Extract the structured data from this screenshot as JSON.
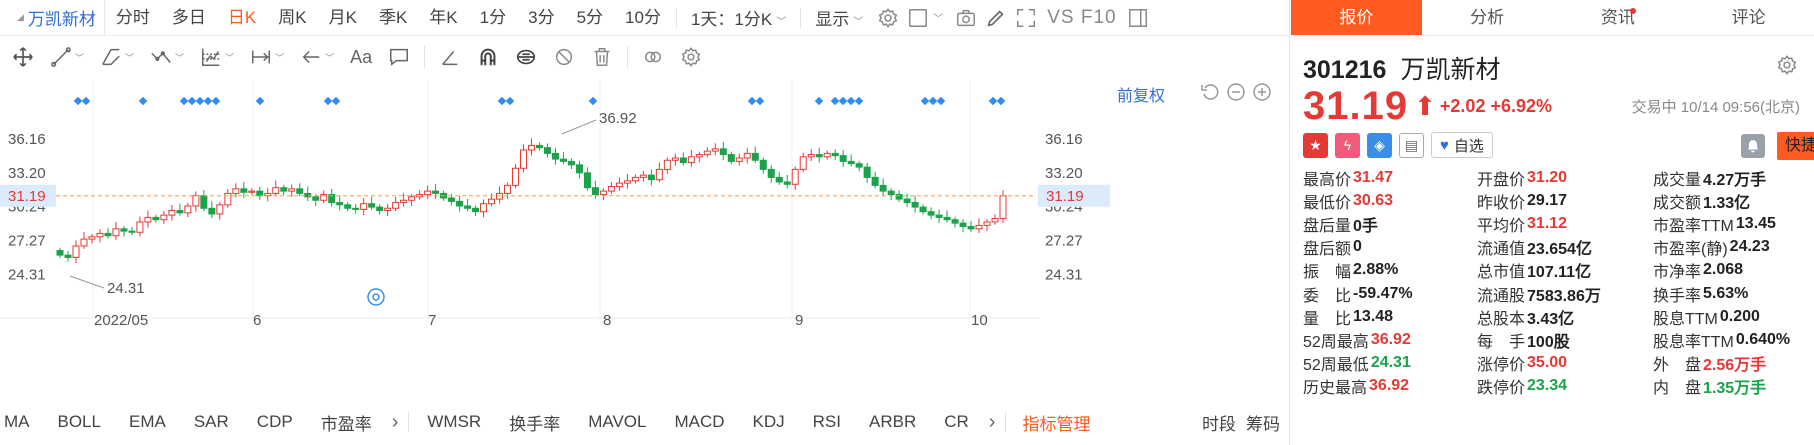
{
  "toolbar": {
    "stock_name": "万凯新材",
    "periods": [
      "分时",
      "多日",
      "日K",
      "周K",
      "月K",
      "季K",
      "年K",
      "1分",
      "3分",
      "5分",
      "10分"
    ],
    "active_period": "日K",
    "interval_select": "1天：1分K",
    "display_menu": "显示",
    "vs_f10": "VS F10"
  },
  "chart": {
    "fuquan_label": "前复权",
    "price_axis_labels": [
      "36.16",
      "33.20",
      "31.19",
      "30.24",
      "27.27",
      "24.31"
    ],
    "current_price_label": "31.19",
    "high_marker": "36.92",
    "low_marker": "24.31",
    "date_labels": [
      "2022/05",
      "6",
      "7",
      "8",
      "9",
      "10"
    ],
    "colors": {
      "up": "#e53935",
      "down": "#1aa34a",
      "signal": "#2f8cf0",
      "current_line": "#f59b4f"
    }
  },
  "indicators": {
    "left": [
      "MA",
      "BOLL",
      "EMA",
      "SAR",
      "CDP",
      "市盈率"
    ],
    "sub": [
      "WMSR",
      "换手率",
      "MAVOL",
      "MACD",
      "KDJ",
      "RSI",
      "ARBR",
      "CR"
    ],
    "manage": "指标管理",
    "right": [
      "时段",
      "筹码"
    ]
  },
  "quote": {
    "tabs": [
      "报价",
      "分析",
      "资讯",
      "评论"
    ],
    "code": "301216",
    "name": "万凯新材",
    "price": "31.19",
    "change": "+2.02 +6.92%",
    "status": "交易中 10/14 09:56(北京)",
    "watch_label": "自选",
    "quick_trade": "快捷交易",
    "rows": [
      [
        [
          "最高价",
          "31.47",
          "red"
        ],
        [
          "开盘价",
          "31.20",
          "red"
        ],
        [
          "成交量",
          "4.27万手",
          "dark"
        ]
      ],
      [
        [
          "最低价",
          "30.63",
          "red"
        ],
        [
          "昨收价",
          "29.17",
          "dark"
        ],
        [
          "成交额",
          "1.33亿",
          "dark"
        ]
      ],
      [
        [
          "盘后量",
          "0手",
          "dark"
        ],
        [
          "平均价",
          "31.12",
          "red"
        ],
        [
          "市盈率TTM",
          "13.45",
          "dark"
        ]
      ],
      [
        [
          "盘后额",
          "0",
          "dark"
        ],
        [
          "流通值",
          "23.654亿",
          "dark"
        ],
        [
          "市盈率(静)",
          "24.23",
          "dark"
        ]
      ],
      [
        [
          "振　幅",
          "2.88%",
          "dark"
        ],
        [
          "总市值",
          "107.11亿",
          "dark"
        ],
        [
          "市净率",
          "2.068",
          "dark"
        ]
      ],
      [
        [
          "委　比",
          "-59.47%",
          "dark"
        ],
        [
          "流通股",
          "7583.86万",
          "dark"
        ],
        [
          "换手率",
          "5.63%",
          "dark"
        ]
      ],
      [
        [
          "量　比",
          "13.48",
          "dark"
        ],
        [
          "总股本",
          "3.43亿",
          "dark"
        ],
        [
          "股息TTM",
          "0.200",
          "dark"
        ]
      ],
      [
        [
          "52周最高",
          "36.92",
          "red"
        ],
        [
          "每　手",
          "100股",
          "dark"
        ],
        [
          "股息率TTM",
          "0.640%",
          "dark"
        ]
      ],
      [
        [
          "52周最低",
          "24.31",
          "green"
        ],
        [
          "涨停价",
          "35.00",
          "red"
        ],
        [
          "外　盘",
          "2.56万手",
          "red"
        ]
      ],
      [
        [
          "历史最高",
          "36.92",
          "red"
        ],
        [
          "跌停价",
          "23.34",
          "green"
        ],
        [
          "内　盘",
          "1.35万手",
          "green"
        ]
      ]
    ]
  }
}
